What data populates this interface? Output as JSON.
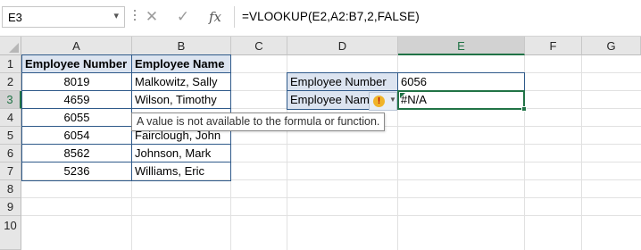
{
  "formula_bar": {
    "name_box": "E3",
    "cancel_icon": "cancel-x-icon",
    "enter_icon": "checkmark-icon",
    "fx_label": "fx",
    "formula": "=VLOOKUP(E2,A2:B7,2,FALSE)"
  },
  "columns": [
    "A",
    "B",
    "C",
    "D",
    "E",
    "F",
    "G"
  ],
  "rows": [
    "1",
    "2",
    "3",
    "4",
    "5",
    "6",
    "7",
    "8",
    "9",
    "10"
  ],
  "table": {
    "headers": [
      "Employee Number",
      "Employee Name"
    ],
    "rows": [
      [
        "8019",
        "Malkowitz, Sally"
      ],
      [
        "4659",
        "Wilson, Timothy"
      ],
      [
        "6055",
        ""
      ],
      [
        "6054",
        "Fairclough, John"
      ],
      [
        "8562",
        "Johnson, Mark"
      ],
      [
        "5236",
        "Williams, Eric"
      ]
    ]
  },
  "lookup": {
    "number_label": "Employee Number",
    "number_value": "6056",
    "name_label": "Employee Nam",
    "name_value": "#N/A"
  },
  "error_button": {
    "icon": "error-warning-icon",
    "dropdown": "chevron-down-icon"
  },
  "tooltip": "A value is not available to the formula or function.",
  "colors": {
    "accent": "#217346",
    "table_header_fill": "#dce4f0",
    "table_border": "#2f5a8a"
  }
}
